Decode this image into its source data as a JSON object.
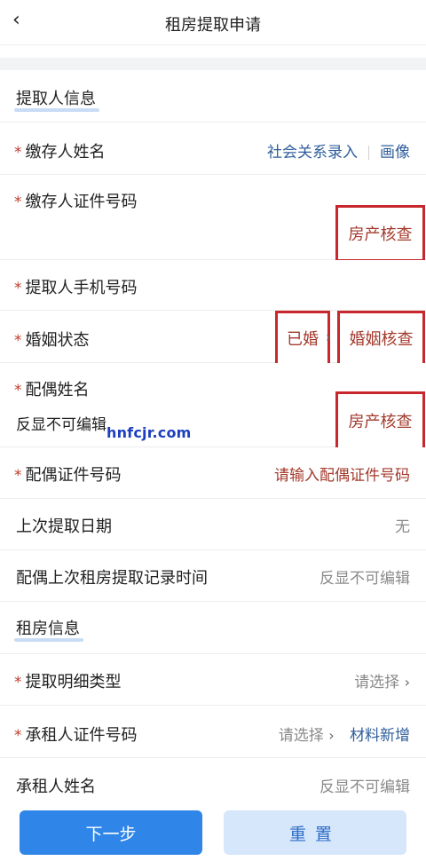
{
  "nav": {
    "back": "‹",
    "title": "租房提取申请"
  },
  "sections": {
    "withdrawer": "提取人信息",
    "rental": "租房信息"
  },
  "rows": {
    "depositor_name": {
      "label": "缴存人姓名",
      "link1": "社会关系录入",
      "link2": "画像"
    },
    "depositor_id": {
      "label": "缴存人证件号码",
      "box": "房产核查"
    },
    "withdrawer_phone": {
      "label": "提取人手机号码"
    },
    "marital": {
      "label": "婚姻状态",
      "value": "已婚",
      "box": "婚姻核查"
    },
    "spouse_name": {
      "label": "配偶姓名",
      "sub": "反显不可编辑",
      "box": "房产核查"
    },
    "spouse_id": {
      "label": "配偶证件号码",
      "placeholder": "请输入配偶证件号码"
    },
    "last_date": {
      "label": "上次提取日期",
      "value": "无"
    },
    "spouse_last": {
      "label": "配偶上次租房提取记录时间",
      "value": "反显不可编辑"
    },
    "detail_type": {
      "label": "提取明细类型",
      "value": "请选择"
    },
    "lessor_id": {
      "label": "承租人证件号码",
      "value": "请选择",
      "link": "材料新增"
    },
    "lessor_name": {
      "label": "承租人姓名",
      "value": "反显不可编辑"
    }
  },
  "watermark": "hnfcjr.com",
  "footer": {
    "next": "下一步",
    "reset": "重置"
  }
}
